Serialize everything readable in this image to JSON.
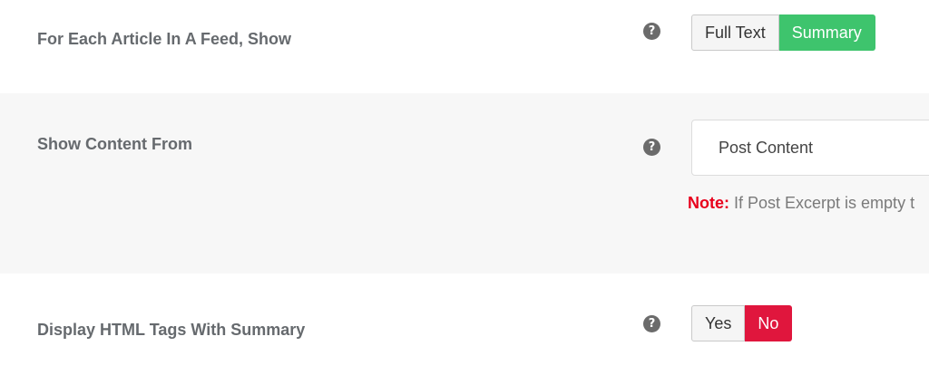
{
  "rows": [
    {
      "label": "For Each Article In A Feed, Show",
      "help_icon": "question-circle-icon",
      "options": [
        "Full Text",
        "Summary"
      ],
      "selected": "Summary",
      "selected_color": "#3ec46d"
    },
    {
      "label": "Show Content From",
      "help_icon": "question-circle-icon",
      "select_value": "Post Content",
      "note_prefix": "Note:",
      "note_text": " If Post Excerpt is empty t",
      "note_prefix_color": "#e8001c"
    },
    {
      "label": "Display HTML Tags With Summary",
      "help_icon": "question-circle-icon",
      "options": [
        "Yes",
        "No"
      ],
      "selected": "No",
      "selected_color": "#e0163d"
    }
  ],
  "help_glyph": "?"
}
